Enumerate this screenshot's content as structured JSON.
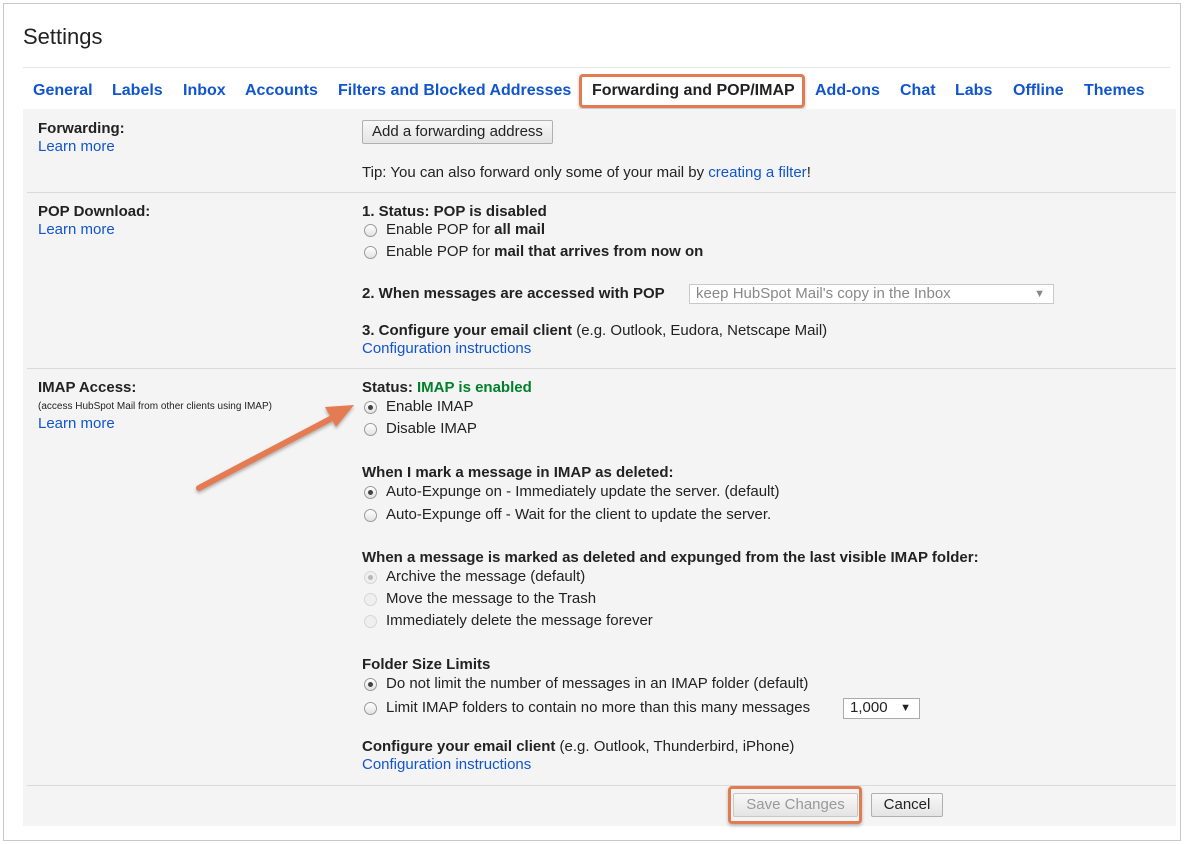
{
  "title": "Settings",
  "tabs": [
    "General",
    "Labels",
    "Inbox",
    "Accounts",
    "Filters and Blocked Addresses",
    "Forwarding and POP/IMAP",
    "Add-ons",
    "Chat",
    "Labs",
    "Offline",
    "Themes"
  ],
  "active_tab": "Forwarding and POP/IMAP",
  "forwarding": {
    "label": "Forwarding:",
    "learn_more": "Learn more",
    "add_button": "Add a forwarding address",
    "tip_prefix": "Tip: You can also forward only some of your mail by ",
    "tip_link": "creating a filter",
    "tip_suffix": "!"
  },
  "pop": {
    "label": "POP Download:",
    "learn_more": "Learn more",
    "status": "1. Status: POP is disabled",
    "opt1_prefix": "Enable POP for ",
    "opt1_bold": "all mail",
    "opt2_prefix": "Enable POP for ",
    "opt2_bold": "mail that arrives from now on",
    "when_label": "2. When messages are accessed with POP",
    "when_select": "keep HubSpot Mail's copy in the Inbox",
    "configure_bold": "3. Configure your email client",
    "configure_rest": " (e.g. Outlook, Eudora, Netscape Mail)",
    "config_link": "Configuration instructions"
  },
  "imap": {
    "label": "IMAP Access:",
    "sublabel": "(access HubSpot Mail from other clients using IMAP)",
    "learn_more": "Learn more",
    "status_prefix": "Status: ",
    "status_value": "IMAP is enabled",
    "enable": "Enable IMAP",
    "disable": "Disable IMAP",
    "deleted_heading": "When I mark a message in IMAP as deleted:",
    "expunge_on": "Auto-Expunge on - Immediately update the server. (default)",
    "expunge_off": "Auto-Expunge off - Wait for the client to update the server.",
    "expunged_heading": "When a message is marked as deleted and expunged from the last visible IMAP folder:",
    "archive": "Archive the message (default)",
    "trash": "Move the message to the Trash",
    "delete_forever": "Immediately delete the message forever",
    "folder_heading": "Folder Size Limits",
    "no_limit": "Do not limit the number of messages in an IMAP folder (default)",
    "limit": "Limit IMAP folders to contain no more than this many messages",
    "limit_select": "1,000",
    "configure_bold": "Configure your email client",
    "configure_rest": " (e.g. Outlook, Thunderbird, iPhone)",
    "config_link": "Configuration instructions"
  },
  "footer": {
    "save": "Save Changes",
    "cancel": "Cancel"
  },
  "colors": {
    "link": "#1155cc",
    "highlight": "#e37b52",
    "status_green": "#00802b",
    "panel": "#f4f4f4"
  }
}
